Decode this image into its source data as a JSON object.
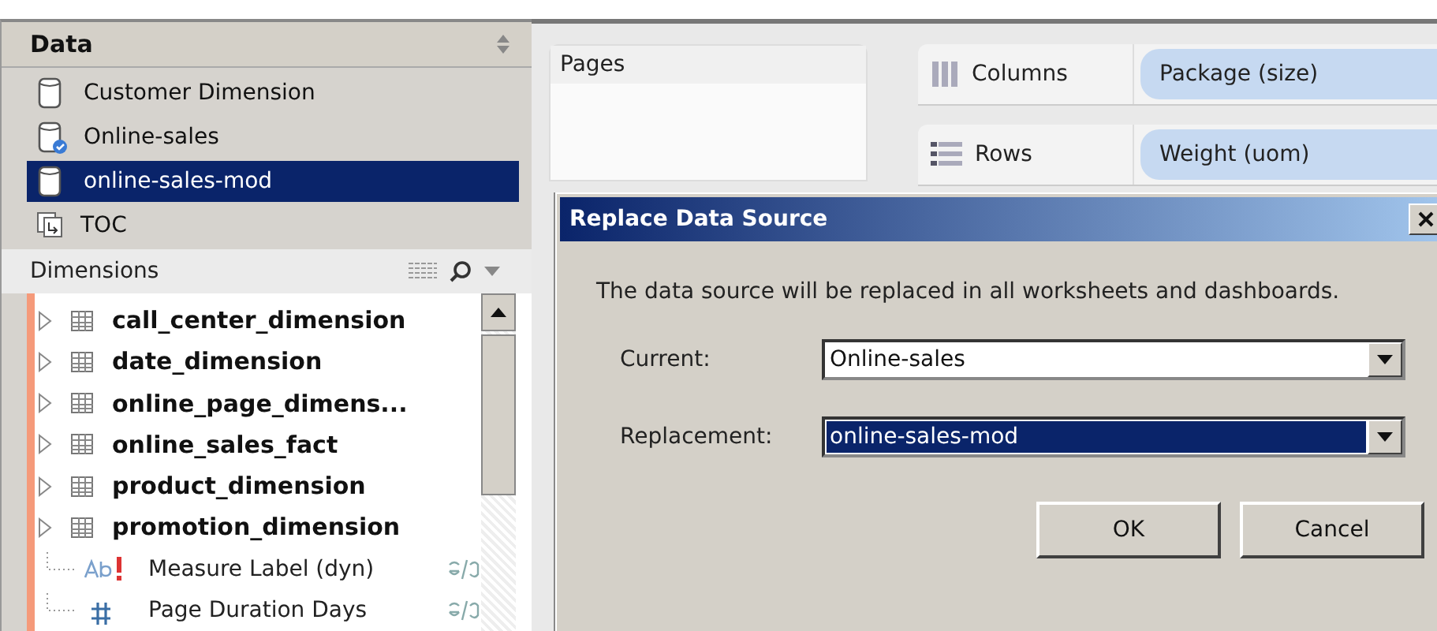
{
  "data_pane": {
    "title": "Data",
    "sources": [
      {
        "label": "Customer Dimension",
        "kind": "source",
        "selected": false
      },
      {
        "label": "Online-sales",
        "kind": "primary",
        "selected": false
      },
      {
        "label": "online-sales-mod",
        "kind": "source",
        "selected": true
      },
      {
        "label": "TOC",
        "kind": "connected",
        "selected": false
      }
    ]
  },
  "dimensions": {
    "title": "Dimensions",
    "items": [
      {
        "label": "call_center_dimension",
        "kind": "table"
      },
      {
        "label": "date_dimension",
        "kind": "table"
      },
      {
        "label": "online_page_dimens...",
        "kind": "table"
      },
      {
        "label": "online_sales_fact",
        "kind": "table"
      },
      {
        "label": "product_dimension",
        "kind": "table"
      },
      {
        "label": "promotion_dimension",
        "kind": "table"
      },
      {
        "label": "Measure Label (dyn)",
        "kind": "text-field"
      },
      {
        "label": "Page Duration Days",
        "kind": "number-field"
      }
    ]
  },
  "pages": {
    "title": "Pages"
  },
  "shelves": [
    {
      "label": "Columns",
      "kind": "columns",
      "pill": "Package (size)"
    },
    {
      "label": "Rows",
      "kind": "rows",
      "pill": "Weight (uom)"
    }
  ],
  "dialog": {
    "title": "Replace Data Source",
    "message": "The data source will be replaced in all worksheets and dashboards.",
    "fields": [
      {
        "label": "Current:",
        "value": "Online-sales",
        "selected": false
      },
      {
        "label": "Replacement:",
        "value": "online-sales-mod",
        "selected": true
      }
    ],
    "buttons": [
      "OK",
      "Cancel"
    ]
  }
}
